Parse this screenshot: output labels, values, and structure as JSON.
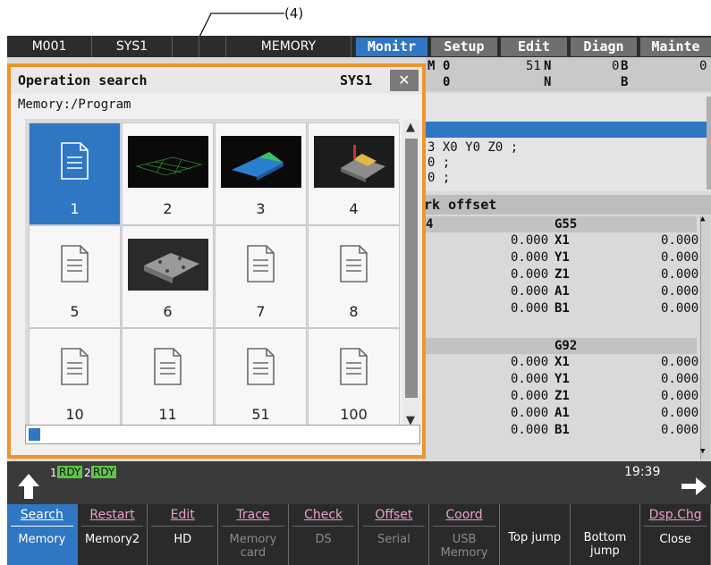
{
  "annotation": {
    "label": "(4)"
  },
  "topbar": {
    "cells": [
      "M001",
      "SYS1",
      "",
      "",
      "MEMORY"
    ],
    "menu_tabs": [
      "Monitr",
      "Setup",
      "Edit",
      "Diagn",
      "Mainte"
    ]
  },
  "status_rows": [
    {
      "c1": "M",
      "c2": "0",
      "c3": "51",
      "c4": "N",
      "c5": "0",
      "c6": "B",
      "c7": "0"
    },
    {
      "c1": "",
      "c2": "0",
      "c3": "",
      "c4": "N",
      "c5": "",
      "c6": "B",
      "c7": ""
    }
  ],
  "program_lines": [
    "3 X0 Y0 Z0 ;",
    "0 ;",
    "0 ;"
  ],
  "work_offset": {
    "title": "rk offset",
    "blocks": [
      {
        "left_id": "4",
        "right_id": "G55",
        "rows": [
          {
            "left": "0.000",
            "axis": "X1",
            "right": "0.000"
          },
          {
            "left": "0.000",
            "axis": "Y1",
            "right": "0.000"
          },
          {
            "left": "0.000",
            "axis": "Z1",
            "right": "0.000"
          },
          {
            "left": "0.000",
            "axis": "A1",
            "right": "0.000"
          },
          {
            "left": "0.000",
            "axis": "B1",
            "right": "0.000"
          }
        ]
      },
      {
        "left_id": "",
        "right_id": "G92",
        "rows": [
          {
            "left": "0.000",
            "axis": "X1",
            "right": "0.000"
          },
          {
            "left": "0.000",
            "axis": "Y1",
            "right": "0.000"
          },
          {
            "left": "0.000",
            "axis": "Z1",
            "right": "0.000"
          },
          {
            "left": "0.000",
            "axis": "A1",
            "right": "0.000"
          },
          {
            "left": "0.000",
            "axis": "B1",
            "right": "0.000"
          }
        ]
      }
    ]
  },
  "popup": {
    "title": "Operation search",
    "system": "SYS1",
    "close_glyph": "✕",
    "path": "Memory:/Program",
    "items": [
      {
        "label": "1",
        "kind": "doc",
        "selected": true
      },
      {
        "label": "2",
        "kind": "thumb-grid"
      },
      {
        "label": "3",
        "kind": "thumb-block"
      },
      {
        "label": "4",
        "kind": "thumb-part"
      },
      {
        "label": "5",
        "kind": "doc"
      },
      {
        "label": "6",
        "kind": "thumb-plate"
      },
      {
        "label": "7",
        "kind": "doc"
      },
      {
        "label": "8",
        "kind": "doc"
      },
      {
        "label": "10",
        "kind": "doc"
      },
      {
        "label": "11",
        "kind": "doc"
      },
      {
        "label": "51",
        "kind": "doc"
      },
      {
        "label": "100",
        "kind": "doc"
      }
    ],
    "progress": 0.02
  },
  "status_bar": {
    "sys1_num": "1",
    "sys1_state": "RDY",
    "sys2_num": "2",
    "sys2_state": "RDY",
    "time": "19:39"
  },
  "softkeys": [
    {
      "top": "Search",
      "bottom": "Memory",
      "active": true
    },
    {
      "top": "Restart",
      "bottom": "Memory2",
      "active": false
    },
    {
      "top": "Edit",
      "bottom": "HD",
      "active": false
    },
    {
      "top": "Trace",
      "bottom": "Memory card",
      "active": false
    },
    {
      "top": "Check",
      "bottom": "DS",
      "active": false
    },
    {
      "top": "Offset",
      "bottom": "Serial",
      "active": false
    },
    {
      "top": "Coord",
      "bottom": "USB Memory",
      "active": false
    },
    {
      "top": "",
      "bottom": "Top jump",
      "active": false
    },
    {
      "top": "",
      "bottom": "Bottom jump",
      "active": false
    },
    {
      "top": "Dsp.Chg",
      "bottom": "Close",
      "active": false
    }
  ],
  "colors": {
    "accent_blue": "#2f76c3",
    "popup_border": "#f0942a",
    "softkey_pink": "#e8a0c8",
    "softkey_disabled": "#8a8a8a",
    "rdy_green": "#5fc24a"
  }
}
